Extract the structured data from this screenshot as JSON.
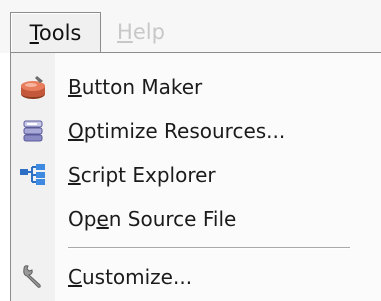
{
  "menubar": {
    "tools": {
      "pre": "",
      "key": "T",
      "post": "ools"
    },
    "help": {
      "pre": "",
      "key": "H",
      "post": "elp"
    }
  },
  "menu": {
    "items": [
      {
        "pre": "",
        "key": "B",
        "post": "utton Maker",
        "icon": "button-maker-icon"
      },
      {
        "pre": "",
        "key": "O",
        "post": "ptimize Resources...",
        "icon": "optimize-resources-icon"
      },
      {
        "pre": "",
        "key": "S",
        "post": "cript Explorer",
        "icon": "script-explorer-icon"
      },
      {
        "pre": "Op",
        "key": "e",
        "post": "n Source File",
        "icon": ""
      },
      {
        "pre": "",
        "key": "C",
        "post": "ustomize...",
        "icon": "customize-wrench-icon"
      }
    ]
  },
  "colors": {
    "disabled": "#c8c8c8",
    "menu_border": "#8c8c8c",
    "icon_strip": "#f1f1f1"
  }
}
